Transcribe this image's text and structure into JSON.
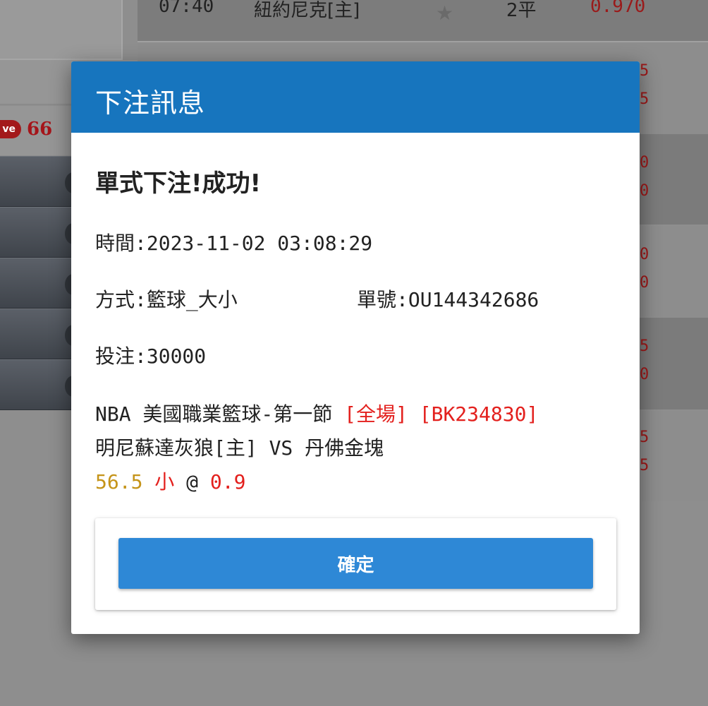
{
  "background": {
    "top_row": {
      "time": "07:40",
      "team": "紐約尼克[主]",
      "star": "★",
      "handicap": "2平",
      "odds": "0.970"
    },
    "live": {
      "badge": "ve",
      "score": "66"
    },
    "odds_fragments": [
      "5",
      "5",
      "0",
      "0",
      "0",
      "0",
      "5",
      "0",
      "5",
      "5"
    ]
  },
  "modal": {
    "title": "下注訊息",
    "status": "單式下注!成功!",
    "time_label": "時間:",
    "time_value": "2023-11-02 03:08:29",
    "method_label": "方式:",
    "method_value": "籃球_大小",
    "ticket_label": "單號:",
    "ticket_value": "OU144342686",
    "stake_label": "投注:",
    "stake_value": "30000",
    "league": "NBA 美國職業籃球-第一節",
    "period_tag": "[全場]",
    "game_code": "[BK234830]",
    "matchup": "明尼蘇達灰狼[主] VS 丹佛金塊",
    "line_value": "56.5",
    "pick": "小",
    "at": "@",
    "odds": "0.9",
    "confirm_label": "確定"
  },
  "colors": {
    "header_blue": "#1775be",
    "button_blue": "#2e88d6",
    "highlight_red": "#e3201d",
    "line_gold": "#c59419"
  }
}
